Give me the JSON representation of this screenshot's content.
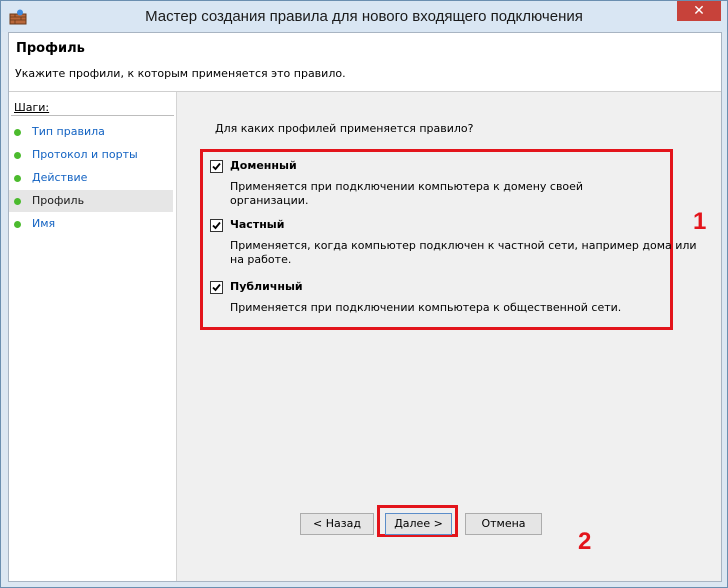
{
  "window": {
    "title": "Мастер создания правила для нового входящего подключения",
    "close_glyph": "✕",
    "accent": "#c7423a"
  },
  "header": {
    "title": "Профиль",
    "subtitle": "Укажите профили, к которым применяется это правило."
  },
  "steps": {
    "title": "Шаги:",
    "items": [
      {
        "label": "Тип правила",
        "active": false
      },
      {
        "label": "Протокол и порты",
        "active": false
      },
      {
        "label": "Действие",
        "active": false
      },
      {
        "label": "Профиль",
        "active": true
      },
      {
        "label": "Имя",
        "active": false
      }
    ],
    "dot_color": "#4cbb2e"
  },
  "content": {
    "question": "Для каких профилей применяется правило?",
    "profiles": [
      {
        "name": "Доменный",
        "checked": true,
        "desc": "Применяется при подключении компьютера к домену своей организации."
      },
      {
        "name": "Частный",
        "checked": true,
        "desc_line1": "Применяется, когда компьютер подключен к частной сети, например дома или",
        "desc_line2": "на работе."
      },
      {
        "name": "Публичный",
        "checked": true,
        "desc": "Применяется при подключении компьютера к общественной сети."
      }
    ]
  },
  "annotations": {
    "marker1": "1",
    "marker2": "2",
    "highlight_color": "#e3141b"
  },
  "buttons": {
    "back": "< Назад",
    "next": "Далее >",
    "cancel": "Отмена"
  }
}
